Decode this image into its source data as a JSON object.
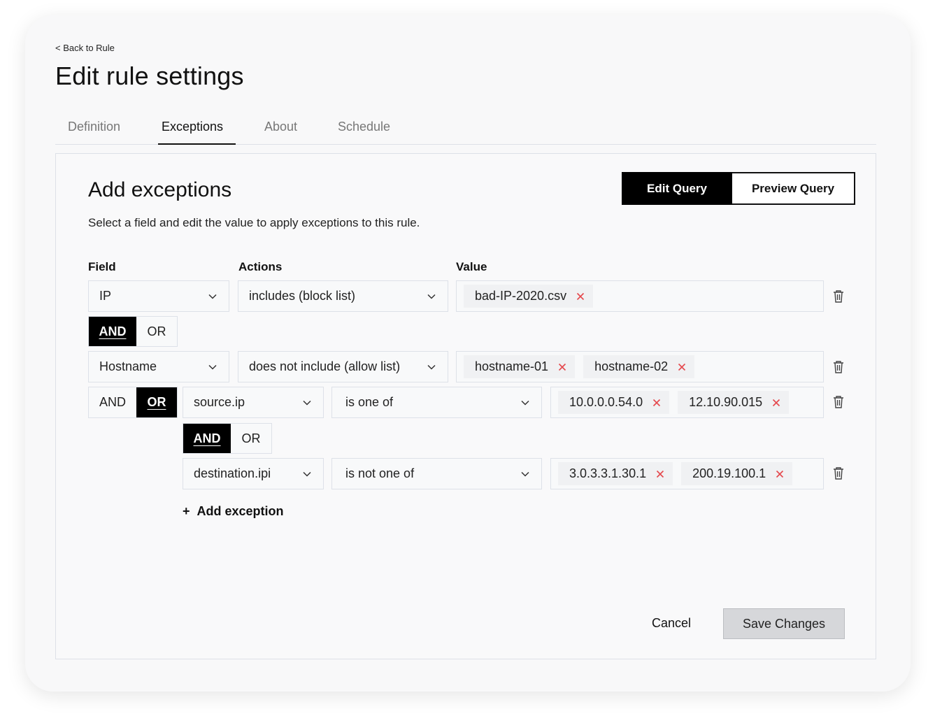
{
  "header": {
    "back_label": "< Back to Rule",
    "title": "Edit rule settings"
  },
  "tabs": [
    {
      "label": "Definition",
      "active": false
    },
    {
      "label": "Exceptions",
      "active": true
    },
    {
      "label": "About",
      "active": false
    },
    {
      "label": "Schedule",
      "active": false
    }
  ],
  "panel": {
    "title": "Add exceptions",
    "subtitle": "Select a field and edit the value to apply exceptions to this rule.",
    "edit_query_label": "Edit Query",
    "preview_query_label": "Preview Query",
    "columns": {
      "field": "Field",
      "actions": "Actions",
      "value": "Value"
    },
    "rows": [
      {
        "field": "IP",
        "action": "includes (block list)",
        "values": [
          "bad-IP-2020.csv"
        ]
      },
      {
        "field": "Hostname",
        "action": "does not include (allow list)",
        "values": [
          "hostname-01",
          "hostname-02"
        ]
      },
      {
        "field": "source.ip",
        "action": "is one of",
        "values": [
          "10.0.0.0.54.0",
          "12.10.90.015"
        ]
      },
      {
        "field": "destination.ipi",
        "action": "is not one of",
        "values": [
          "3.0.3.3.1.30.1",
          "200.19.100.1"
        ]
      }
    ],
    "logic": [
      {
        "and_label": "AND",
        "or_label": "OR",
        "selected": "AND"
      },
      {
        "and_label": "AND",
        "or_label": "OR",
        "selected": "OR"
      },
      {
        "and_label": "AND",
        "or_label": "OR",
        "selected": "AND"
      }
    ],
    "add_exception_label": "Add exception",
    "add_icon": "+"
  },
  "footer": {
    "cancel_label": "Cancel",
    "save_label": "Save Changes"
  },
  "colors": {
    "remove_x": "#e5484d",
    "primary": "#000000",
    "save_bg": "#d6d7da"
  }
}
